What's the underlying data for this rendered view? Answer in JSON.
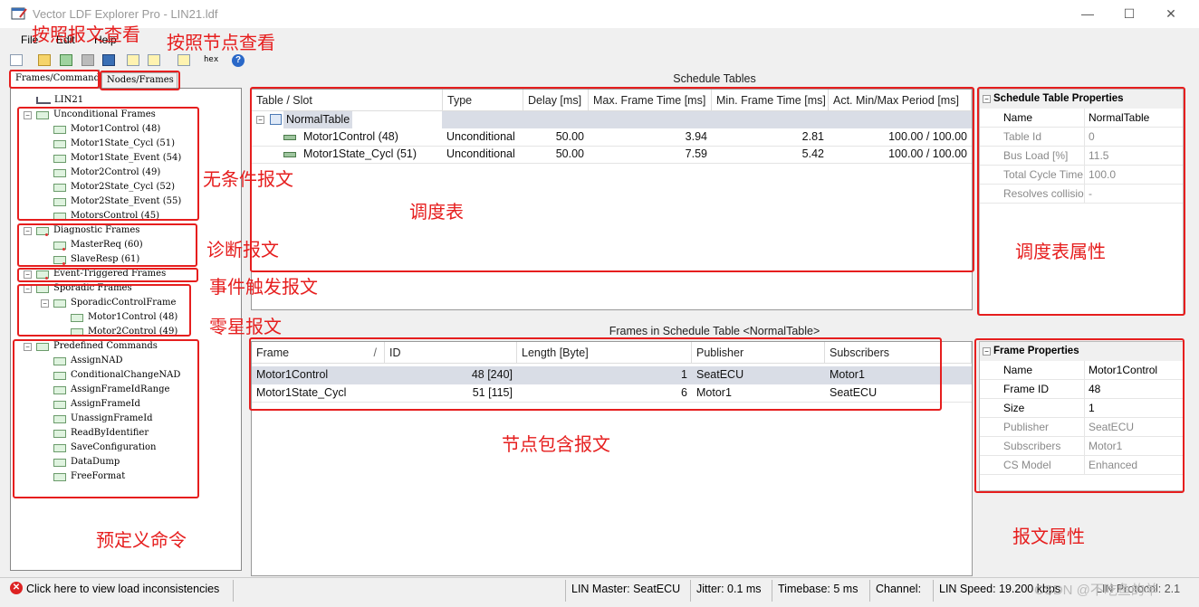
{
  "window": {
    "title": "Vector LDF Explorer Pro - LIN21.ldf",
    "minimize": "—",
    "maximize": "☐",
    "close": "✕"
  },
  "menu": [
    "File",
    "Edit",
    "Help"
  ],
  "toolbar": {
    "hex_label": "hex"
  },
  "tabs": {
    "frames": "Frames/Commands",
    "nodes": "Nodes/Frames"
  },
  "tree": {
    "root": "LIN21",
    "groups": [
      {
        "label": "Unconditional Frames",
        "items": [
          "Motor1Control (48)",
          "Motor1State_Cycl (51)",
          "Motor1State_Event (54)",
          "Motor2Control (49)",
          "Motor2State_Cycl (52)",
          "Motor2State_Event (55)",
          "MotorsControl (45)"
        ]
      },
      {
        "label": "Diagnostic Frames",
        "items": [
          "MasterReq (60)",
          "SlaveResp (61)"
        ]
      },
      {
        "label": "Event-Triggered Frames",
        "items": []
      },
      {
        "label": "Sporadic Frames",
        "items": [
          "SporadicControlFrame"
        ],
        "subitems": [
          "Motor1Control (48)",
          "Motor2Control (49)"
        ]
      },
      {
        "label": "Predefined Commands",
        "items": [
          "AssignNAD",
          "ConditionalChangeNAD",
          "AssignFrameIdRange",
          "AssignFrameId",
          "UnassignFrameId",
          "ReadByIdentifier",
          "SaveConfiguration",
          "DataDump",
          "FreeFormat"
        ]
      }
    ]
  },
  "schedule": {
    "header": "Schedule Tables",
    "columns": [
      "Table / Slot",
      "Type",
      "Delay [ms]",
      "Max. Frame Time [ms]",
      "Min. Frame Time [ms]",
      "Act. Min/Max Period [ms]"
    ],
    "table_name": "NormalTable",
    "rows": [
      {
        "slot": "Motor1Control (48)",
        "type": "Unconditional",
        "delay": "50.00",
        "max": "3.94",
        "min": "2.81",
        "period": "100.00 / 100.00"
      },
      {
        "slot": "Motor1State_Cycl (51)",
        "type": "Unconditional",
        "delay": "50.00",
        "max": "7.59",
        "min": "5.42",
        "period": "100.00 / 100.00"
      }
    ]
  },
  "schedule_props": {
    "header": "Schedule Table Properties",
    "rows": [
      {
        "key": "Name",
        "value": "NormalTable",
        "dim": false
      },
      {
        "key": "Table Id",
        "value": "0",
        "dim": true
      },
      {
        "key": "Bus Load [%]",
        "value": "11.5",
        "dim": true
      },
      {
        "key": "Total Cycle Time",
        "value": "100.0",
        "dim": true
      },
      {
        "key": "Resolves collision",
        "value": "-",
        "dim": true
      }
    ]
  },
  "frames": {
    "header": "Frames in Schedule Table <NormalTable>",
    "columns": [
      "Frame",
      "ID",
      "Length [Byte]",
      "Publisher",
      "Subscribers"
    ],
    "sort_glyph": "/",
    "rows": [
      {
        "frame": "Motor1Control",
        "id": "48 [240]",
        "length": "1",
        "publisher": "SeatECU",
        "subscribers": "Motor1"
      },
      {
        "frame": "Motor1State_Cycl",
        "id": "51 [115]",
        "length": "6",
        "publisher": "Motor1",
        "subscribers": "SeatECU"
      }
    ]
  },
  "frame_props": {
    "header": "Frame Properties",
    "rows": [
      {
        "key": "Name",
        "value": "Motor1Control",
        "dim": false
      },
      {
        "key": "Frame ID",
        "value": "48",
        "dim": false
      },
      {
        "key": "Size",
        "value": "1",
        "dim": false
      },
      {
        "key": "Publisher",
        "value": "SeatECU",
        "dim": true
      },
      {
        "key": "Subscribers",
        "value": "Motor1",
        "dim": true
      },
      {
        "key": "CS Model",
        "value": "Enhanced",
        "dim": true
      }
    ]
  },
  "annotations": {
    "by_frame": "按照报文查看",
    "by_node": "按照节点查看",
    "unconditional": "无条件报文",
    "diagnostic": "诊断报文",
    "event": "事件触发报文",
    "sporadic": "零星报文",
    "predefined": "预定义命令",
    "schedule": "调度表",
    "schedule_props": "调度表属性",
    "node_frames": "节点包含报文",
    "frame_props": "报文属性"
  },
  "status": {
    "inconsistency": "Click here to view load inconsistencies",
    "master": "LIN Master: SeatECU",
    "jitter": "Jitter: 0.1 ms",
    "timebase": "Timebase: 5 ms",
    "channel": "Channel:",
    "speed": "LIN Speed: 19.200 kbps",
    "protocol": "LIN Protocol: 2.1",
    "watermark": "CSDN @不吃鱼的羊"
  },
  "colors": {
    "annotation": "#e61e1e",
    "selected_row": "#d9dde6"
  }
}
